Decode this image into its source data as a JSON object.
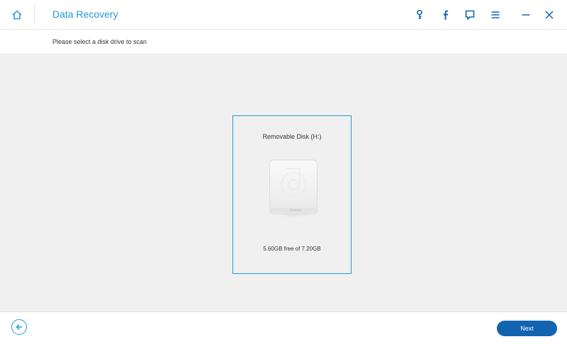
{
  "window": {
    "title": "Data Recovery",
    "accent_color": "#1e9ad6",
    "toolbar_icons": [
      "home-icon",
      "key-icon",
      "facebook-icon",
      "feedback-icon",
      "menu-icon",
      "minimize-icon",
      "close-icon"
    ]
  },
  "subheader": {
    "instruction": "Please select a disk drive to scan"
  },
  "disks": [
    {
      "name": "Removable Disk (H:)",
      "space": "5.60GB free of 7.20GB",
      "selected": true,
      "icon": "hard-drive-icon"
    }
  ],
  "footer": {
    "back_icon": "arrow-left-icon",
    "next_label": "Next",
    "next_color": "#1263b0"
  }
}
